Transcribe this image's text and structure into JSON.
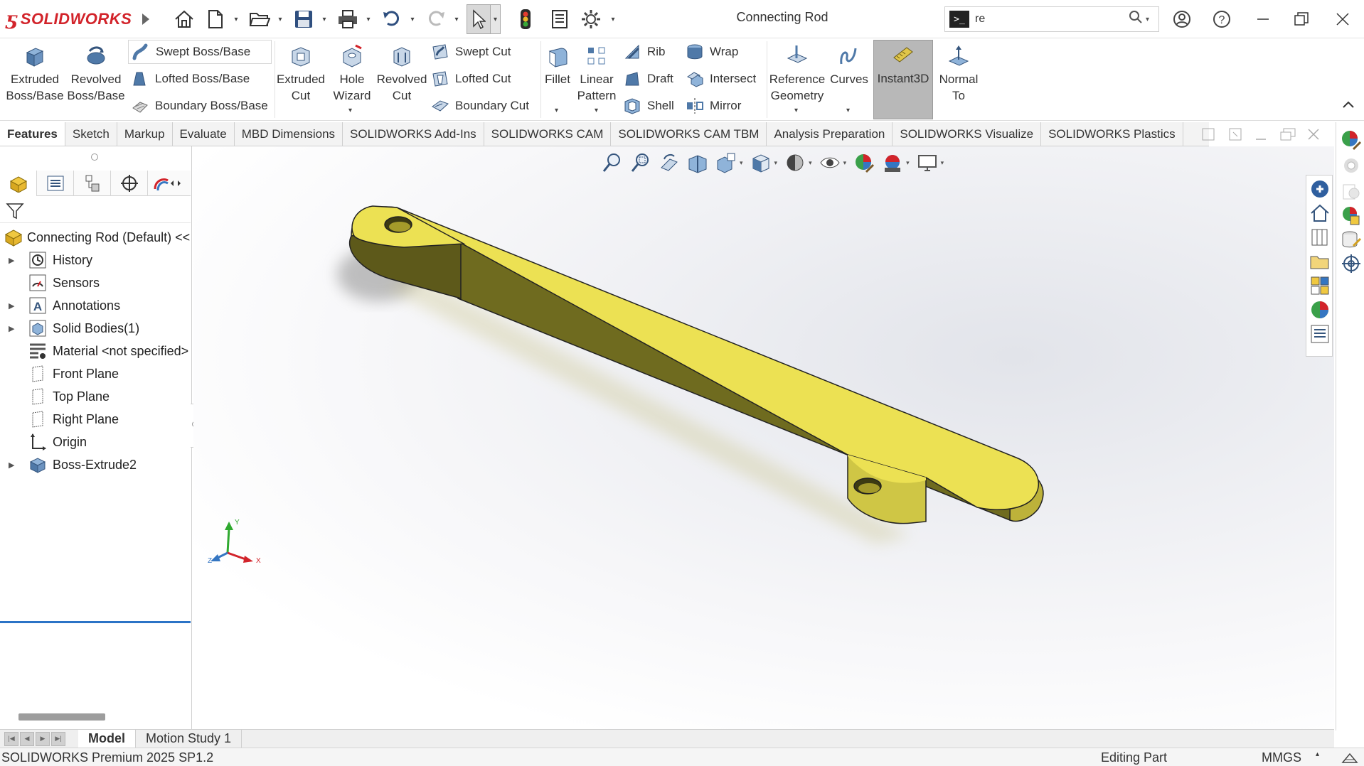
{
  "app": {
    "brand": "SOLIDWORKS",
    "document_title": "Connecting Rod",
    "search_value": "re"
  },
  "ribbon": {
    "extruded_boss": [
      "Extruded",
      "Boss/Base"
    ],
    "revolved_boss": [
      "Revolved",
      "Boss/Base"
    ],
    "swept_boss": "Swept Boss/Base",
    "lofted_boss": "Lofted Boss/Base",
    "boundary_boss": "Boundary Boss/Base",
    "extruded_cut": [
      "Extruded",
      "Cut"
    ],
    "hole_wizard": [
      "Hole",
      "Wizard"
    ],
    "revolved_cut": [
      "Revolved",
      "Cut"
    ],
    "swept_cut": "Swept Cut",
    "lofted_cut": "Lofted Cut",
    "boundary_cut": "Boundary Cut",
    "fillet": "Fillet",
    "linear_pattern": [
      "Linear",
      "Pattern"
    ],
    "rib": "Rib",
    "draft": "Draft",
    "shell": "Shell",
    "wrap": "Wrap",
    "intersect": "Intersect",
    "mirror": "Mirror",
    "reference_geometry": [
      "Reference",
      "Geometry"
    ],
    "curves": "Curves",
    "instant3d": "Instant3D",
    "normal_to": [
      "Normal",
      "To"
    ]
  },
  "tabs": [
    "Features",
    "Sketch",
    "Markup",
    "Evaluate",
    "MBD Dimensions",
    "SOLIDWORKS Add-Ins",
    "SOLIDWORKS CAM",
    "SOLIDWORKS CAM TBM",
    "Analysis Preparation",
    "SOLIDWORKS Visualize",
    "SOLIDWORKS Plastics"
  ],
  "tree": {
    "root": "Connecting Rod  (Default) <<",
    "items": [
      "History",
      "Sensors",
      "Annotations",
      "Solid Bodies(1)",
      "Material <not specified>",
      "Front Plane",
      "Top Plane",
      "Right Plane",
      "Origin",
      "Boss-Extrude2"
    ]
  },
  "bottom_tabs": [
    "Model",
    "Motion Study 1"
  ],
  "status": {
    "product": "SOLIDWORKS Premium 2025 SP1.2",
    "mode": "Editing Part",
    "units": "MMGS"
  },
  "triad": {
    "x": "X",
    "y": "Y",
    "z": "Z"
  },
  "colors": {
    "part_top": "#ece153",
    "part_side": "#6f6b1f",
    "brand_red": "#d2232a",
    "selection_blue": "#2b73c6"
  }
}
